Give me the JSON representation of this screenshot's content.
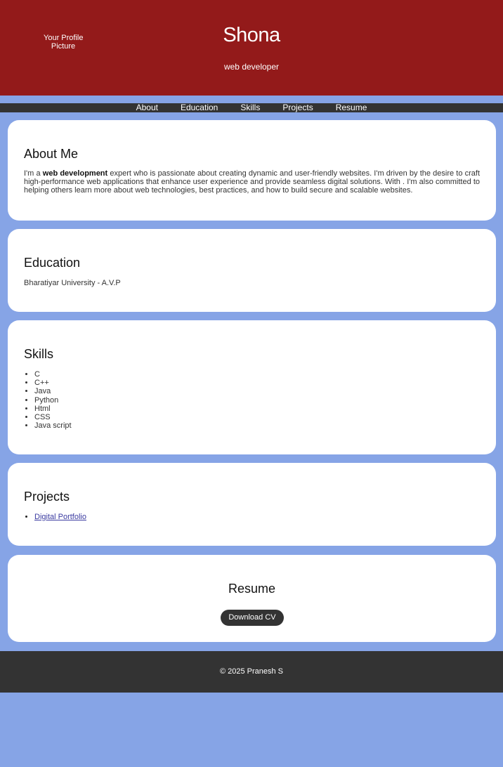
{
  "header": {
    "profile_alt_line1": "Your Profile",
    "profile_alt_line2": "Picture",
    "name": "Shona",
    "role": "web developer"
  },
  "nav": [
    "About",
    "Education",
    "Skills",
    "Projects",
    "Resume"
  ],
  "about": {
    "heading": "About Me",
    "intro": "I'm a ",
    "highlight": "web development",
    "body": " expert who is passionate about creating dynamic and user-friendly websites. I'm driven by the desire to craft high-performance web applications that enhance user experience and provide seamless digital solutions. With . I'm also committed to helping others learn more about web technologies, best practices, and how to build secure and scalable websites."
  },
  "education": {
    "heading": "Education",
    "text": "Bharatiyar University - A.V.P"
  },
  "skills": {
    "heading": "Skills",
    "items": [
      "C",
      "C++",
      "Java",
      "Python",
      "Html",
      "CSS",
      "Java script"
    ]
  },
  "projects": {
    "heading": "Projects",
    "items": [
      "Digital Portfolio"
    ]
  },
  "resume": {
    "heading": "Resume",
    "button": "Download CV"
  },
  "footer": {
    "text": "© 2025 Pranesh S"
  },
  "colors": {
    "header_bg": "#931a1a",
    "page_bg": "#86a4e6",
    "nav_bg": "#333333",
    "card_bg": "#ffffff"
  }
}
